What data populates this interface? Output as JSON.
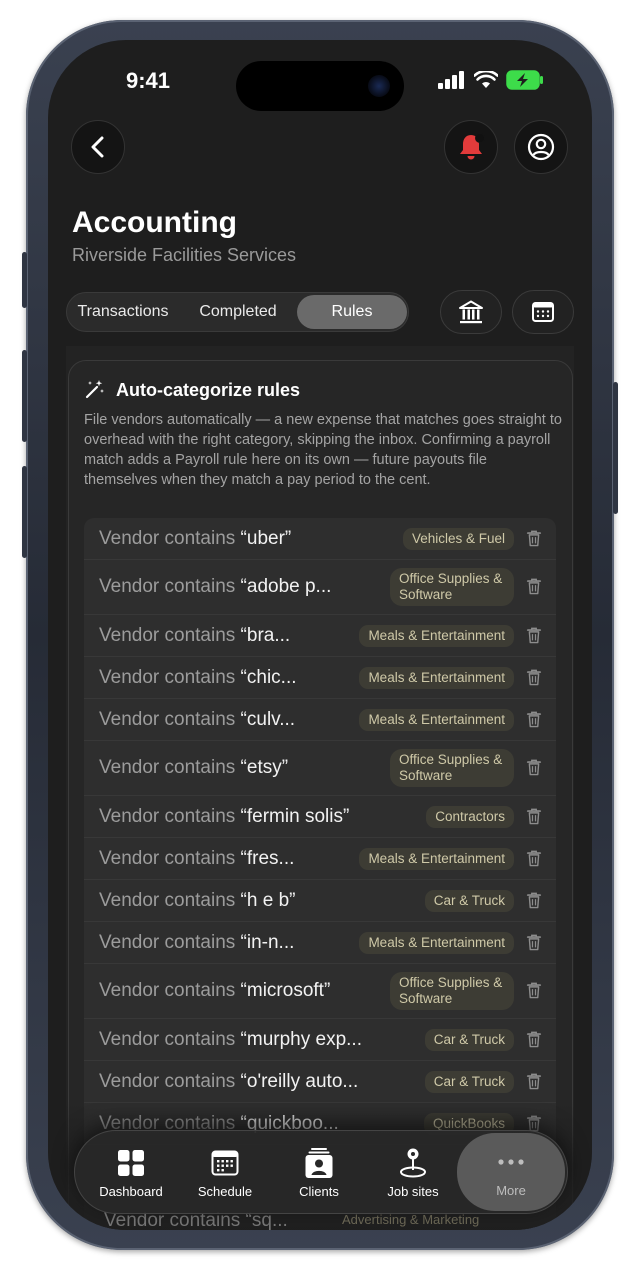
{
  "status": {
    "time": "9:41"
  },
  "header": {
    "title": "Accounting",
    "subtitle": "Riverside Facilities Services"
  },
  "tabs": [
    {
      "label": "Transactions",
      "active": false
    },
    {
      "label": "Completed",
      "active": false
    },
    {
      "label": "Rules",
      "active": true
    }
  ],
  "card": {
    "title": "Auto-categorize rules",
    "description": "File vendors automatically — a new expense that matches goes straight to overhead with the right category, skipping the inbox. Confirming a payroll match adds a Payroll rule here on its own — future payouts file themselves when they match a pay period to the cent."
  },
  "rules": [
    {
      "prefix": "Vendor contains ",
      "term": "“uber”",
      "category": "Vehicles & Fuel"
    },
    {
      "prefix": "Vendor contains ",
      "term": "“adobe p...",
      "category": "Office Supplies & Software"
    },
    {
      "prefix": "Vendor contains ",
      "term": "“bra...",
      "category": "Meals & Entertainment"
    },
    {
      "prefix": "Vendor contains ",
      "term": "“chic...",
      "category": "Meals & Entertainment"
    },
    {
      "prefix": "Vendor contains ",
      "term": "“culv...",
      "category": "Meals & Entertainment"
    },
    {
      "prefix": "Vendor contains ",
      "term": "“etsy”",
      "category": "Office Supplies & Software"
    },
    {
      "prefix": "Vendor contains ",
      "term": "“fermin solis”",
      "category": "Contractors"
    },
    {
      "prefix": "Vendor contains ",
      "term": "“fres...",
      "category": "Meals & Entertainment"
    },
    {
      "prefix": "Vendor contains ",
      "term": "“h e b”",
      "category": "Car & Truck"
    },
    {
      "prefix": "Vendor contains ",
      "term": "“in-n...",
      "category": "Meals & Entertainment"
    },
    {
      "prefix": "Vendor contains ",
      "term": "“microsoft”",
      "category": "Office Supplies & Software"
    },
    {
      "prefix": "Vendor contains ",
      "term": "“murphy exp...",
      "category": "Car & Truck"
    },
    {
      "prefix": "Vendor contains ",
      "term": "“o'reilly auto...",
      "category": "Car & Truck"
    },
    {
      "prefix": "Vendor contains ",
      "term": "“quickboo...",
      "category": "QuickBooks"
    }
  ],
  "ghost_rule": {
    "text": "Vendor contains “sq...",
    "category": "Advertising & Marketing"
  },
  "tabbar": [
    {
      "label": "Dashboard",
      "icon": "grid-icon"
    },
    {
      "label": "Schedule",
      "icon": "calendar-icon"
    },
    {
      "label": "Clients",
      "icon": "contacts-icon"
    },
    {
      "label": "Job sites",
      "icon": "map-pin-icon"
    },
    {
      "label": "More",
      "icon": "ellipsis-icon",
      "active": true
    }
  ],
  "colors": {
    "background": "#1e1e1e",
    "badge_bg": "#3d3c34",
    "badge_text": "#cfc9a8",
    "bell": "#e23b3b",
    "battery": "#3ddc4a"
  }
}
